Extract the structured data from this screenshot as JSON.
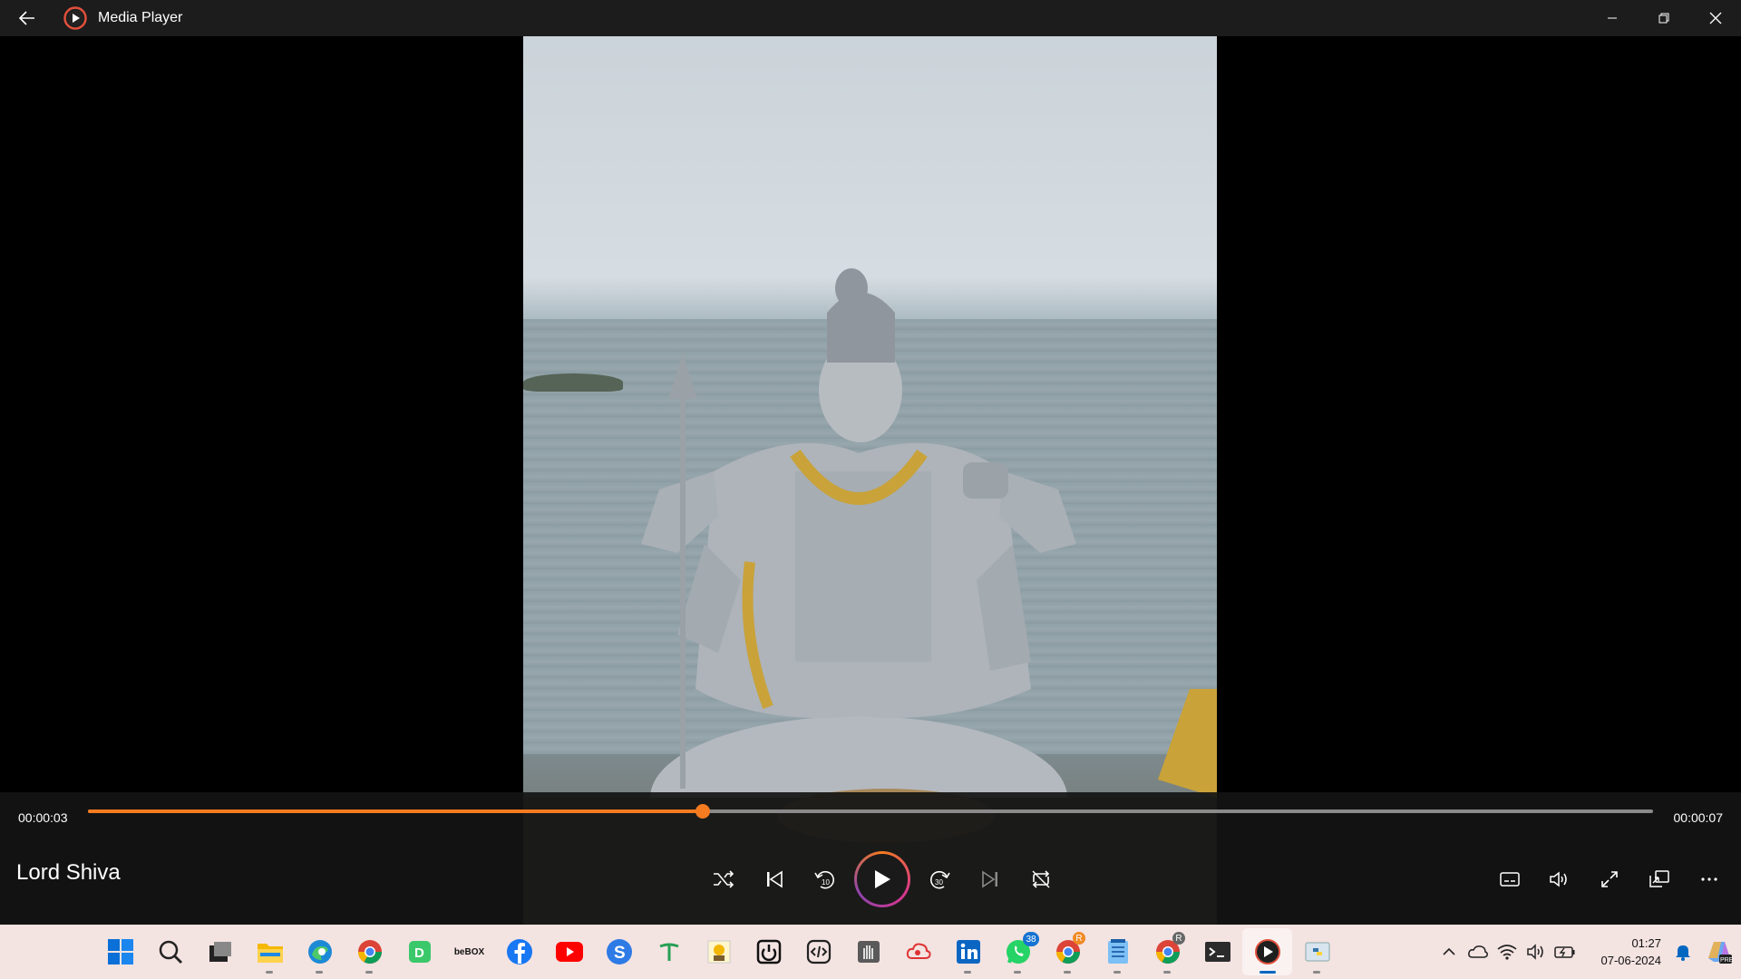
{
  "window": {
    "title": "Media Player"
  },
  "player": {
    "current_time": "00:00:03",
    "total_time": "00:00:07",
    "progress_fraction": 0.393,
    "media_title": "Lord Shiva",
    "accent_color": "#f47b20"
  },
  "controls": {
    "center": [
      "shuffle-icon",
      "previous-icon",
      "skip-back-10-icon",
      "play-icon",
      "skip-forward-30-icon",
      "next-icon",
      "repeat-icon"
    ],
    "right": [
      "captions-icon",
      "volume-icon",
      "fullscreen-icon",
      "mini-player-icon",
      "more-icon"
    ]
  },
  "taskbar": {
    "apps": [
      "start",
      "search",
      "task-view",
      "file-explorer",
      "edge",
      "chrome-profile",
      "d-app",
      "beBOX",
      "facebook",
      "youtube",
      "s-app",
      "t-app",
      "photo-app",
      "power-app",
      "code-app",
      "hand-app",
      "cloud-app",
      "linkedin",
      "whatsapp",
      "chrome-r",
      "notepad",
      "chrome-r2",
      "terminal",
      "media-player",
      "python"
    ],
    "whatsapp_badge": "38",
    "chrome_badge": "R",
    "chrome2_badge": "R",
    "beBOX_label": "beBOX"
  },
  "tray": {
    "time": "01:27",
    "date": "07-06-2024"
  }
}
